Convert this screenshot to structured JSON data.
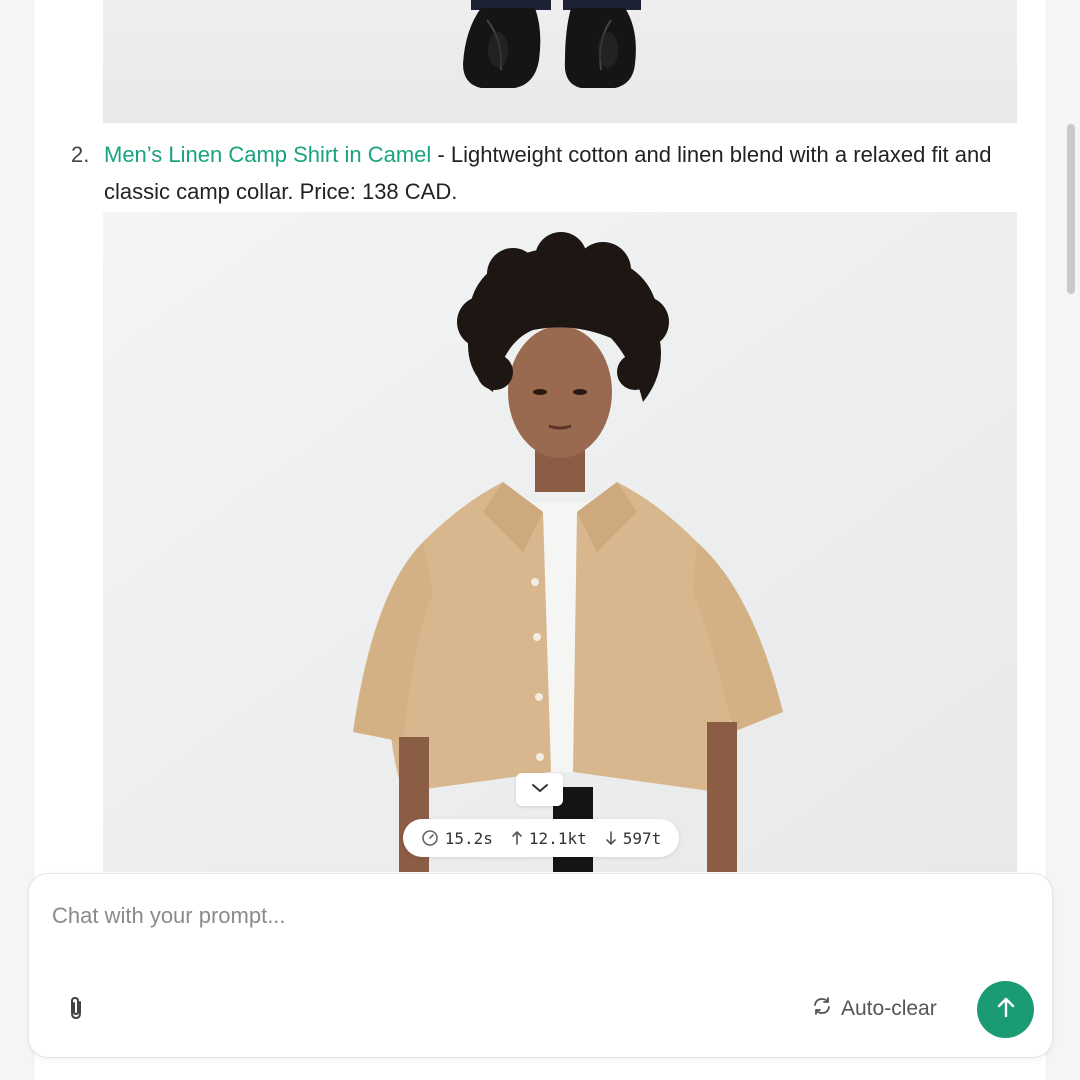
{
  "list": {
    "number": "2.",
    "product_link": "Men’s Linen Camp Shirt in Camel",
    "description": " - Lightweight cotton and linen blend with a relaxed fit and classic camp collar. Price: 138 CAD."
  },
  "stats": {
    "duration": "15.2s",
    "tokens_in": "12.1kt",
    "tokens_out": "597t"
  },
  "chat": {
    "placeholder": "Chat with your prompt...",
    "autoclear_label": "Auto-clear"
  },
  "colors": {
    "link": "#19a380",
    "send_button": "#1a9b74"
  },
  "icons": {
    "attach": "paperclip-icon",
    "autoclear": "refresh-icon",
    "send": "arrow-up-icon",
    "scroll_down": "chevron-down-icon",
    "duration": "gauge-icon",
    "tokens_in": "arrow-up-small-icon",
    "tokens_out": "arrow-down-small-icon"
  }
}
